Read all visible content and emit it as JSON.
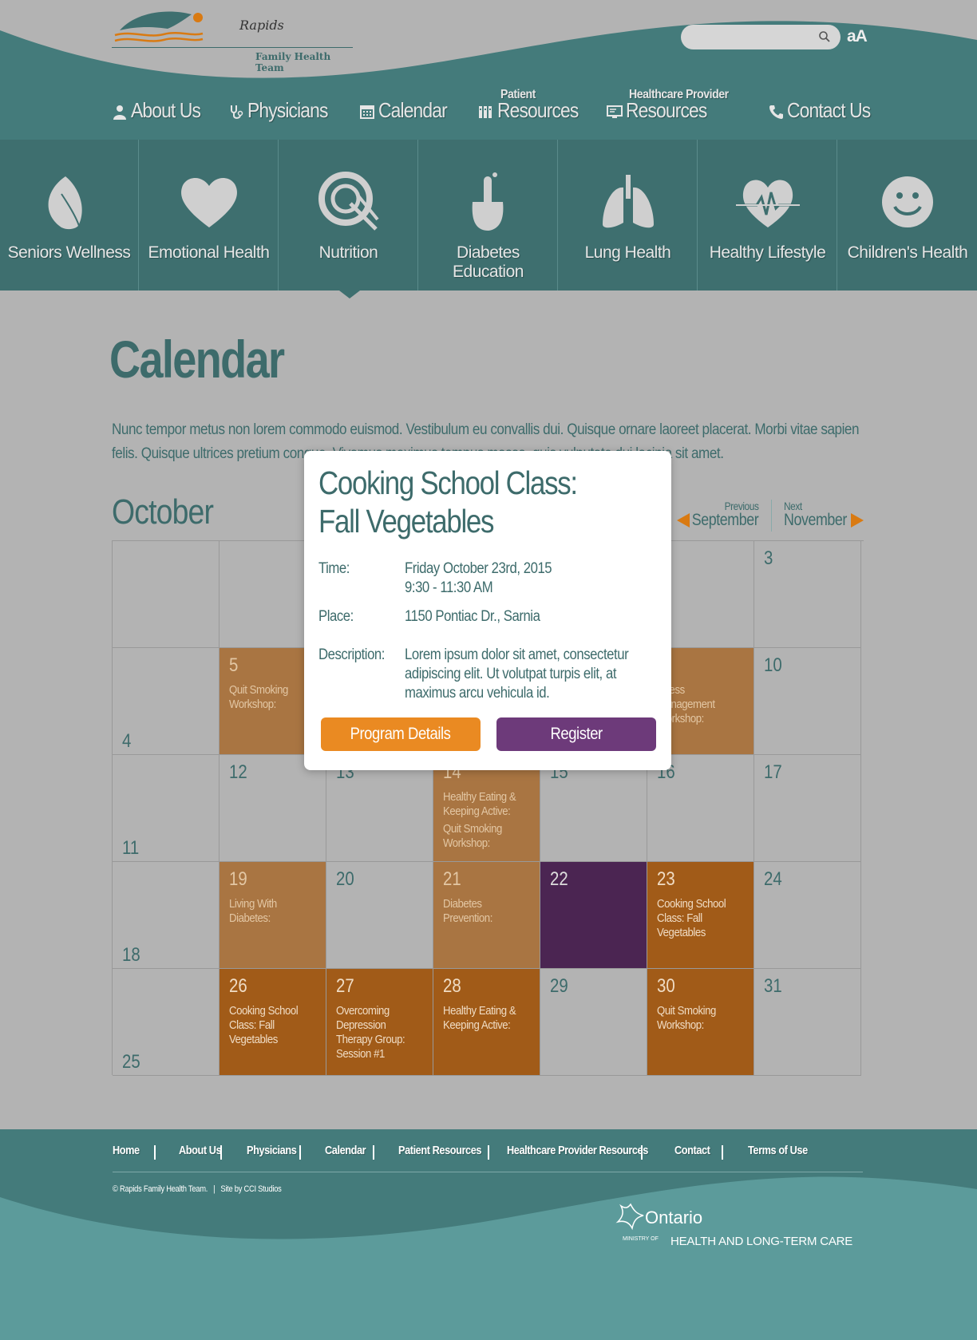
{
  "brand": {
    "name_top": "Rapids",
    "name_bottom": "Family Health Team"
  },
  "header": {
    "search_placeholder": "",
    "text_size_label": "aA"
  },
  "nav": [
    {
      "label": "About Us",
      "sup": "",
      "icon": "person-icon"
    },
    {
      "label": "Physicians",
      "sup": "",
      "icon": "stethoscope-icon"
    },
    {
      "label": "Calendar",
      "sup": "",
      "icon": "calendar-icon"
    },
    {
      "label": "Resources",
      "sup": "Patient",
      "icon": "books-icon"
    },
    {
      "label": "Resources",
      "sup": "Healthcare Provider",
      "icon": "monitor-icon"
    },
    {
      "label": "Contact Us",
      "sup": "",
      "icon": "phone-icon"
    }
  ],
  "categories": [
    {
      "label": "Seniors Wellness",
      "icon": "leaf-icon"
    },
    {
      "label": "Emotional Health",
      "icon": "heart-icon"
    },
    {
      "label": "Nutrition",
      "icon": "plate-fork-knife-icon",
      "active": true
    },
    {
      "label": "Diabetes Education",
      "icon": "finger-prick-icon"
    },
    {
      "label": "Lung Health",
      "icon": "lungs-icon"
    },
    {
      "label": "Healthy Lifestyle",
      "icon": "heartbeat-icon"
    },
    {
      "label": "Children's Health",
      "icon": "smiley-icon"
    }
  ],
  "page": {
    "title": "Calendar",
    "intro": "Nunc tempor metus non lorem commodo euismod. Vestibulum eu convallis dui. Quisque ornare laoreet placerat. Morbi vitae sapien felis. Quisque ultrices pretium congue. Vivamus maximus tempus massa, quis vulputate dui lacinia sit amet."
  },
  "calendar": {
    "month": "October",
    "prev_small": "Previous",
    "prev_big": "September",
    "next_small": "Next",
    "next_big": "November",
    "days": [
      {
        "num": "",
        "style": "",
        "events": []
      },
      {
        "num": "",
        "style": "",
        "events": []
      },
      {
        "num": "",
        "style": "",
        "events": []
      },
      {
        "num": "",
        "style": "",
        "events": []
      },
      {
        "num": "",
        "style": "",
        "events": []
      },
      {
        "num": "",
        "style": "",
        "events": []
      },
      {
        "num": "3",
        "style": "",
        "events": []
      },
      {
        "num": "4",
        "style": "",
        "events": [],
        "bottom": true
      },
      {
        "num": "5",
        "style": "light",
        "events": [
          "Quit Smoking Workshop:"
        ]
      },
      {
        "num": "",
        "style": "",
        "events": []
      },
      {
        "num": "",
        "style": "",
        "events": []
      },
      {
        "num": "",
        "style": "",
        "events": []
      },
      {
        "num": "",
        "style": "light",
        "events": [
          "Stress Management Workshop:"
        ]
      },
      {
        "num": "10",
        "style": "",
        "events": []
      },
      {
        "num": "11",
        "style": "",
        "events": [],
        "bottom": true
      },
      {
        "num": "12",
        "style": "",
        "events": []
      },
      {
        "num": "13",
        "style": "",
        "events": []
      },
      {
        "num": "14",
        "style": "light",
        "events": [
          "Healthy Eating & Keeping Active:",
          "Quit Smoking Workshop:"
        ]
      },
      {
        "num": "15",
        "style": "",
        "events": []
      },
      {
        "num": "16",
        "style": "",
        "events": []
      },
      {
        "num": "17",
        "style": "",
        "events": []
      },
      {
        "num": "18",
        "style": "",
        "events": [],
        "bottom": true
      },
      {
        "num": "19",
        "style": "light",
        "events": [
          "Living With Diabetes:"
        ]
      },
      {
        "num": "20",
        "style": "",
        "events": []
      },
      {
        "num": "21",
        "style": "light",
        "events": [
          "Diabetes Prevention:"
        ]
      },
      {
        "num": "22",
        "style": "purple",
        "events": []
      },
      {
        "num": "23",
        "style": "dark",
        "events": [
          "Cooking School Class: Fall Vegetables"
        ]
      },
      {
        "num": "24",
        "style": "",
        "events": []
      },
      {
        "num": "25",
        "style": "",
        "events": [],
        "bottom": true
      },
      {
        "num": "26",
        "style": "dark",
        "events": [
          "Cooking School Class: Fall Vegetables"
        ]
      },
      {
        "num": "27",
        "style": "dark",
        "events": [
          "Overcoming Depression Therapy Group: Session #1"
        ]
      },
      {
        "num": "28",
        "style": "dark",
        "events": [
          "Healthy Eating & Keeping Active:"
        ]
      },
      {
        "num": "29",
        "style": "",
        "events": []
      },
      {
        "num": "30",
        "style": "dark",
        "events": [
          "Quit Smoking Workshop:"
        ]
      },
      {
        "num": "31",
        "style": "",
        "events": []
      }
    ]
  },
  "modal": {
    "title_line1": "Cooking School Class:",
    "title_line2": "Fall Vegetables",
    "time_label": "Time:",
    "time_line1": "Friday October 23rd, 2015",
    "time_line2": "9:30 - 11:30 AM",
    "place_label": "Place:",
    "place_value": "1150 Pontiac Dr., Sarnia",
    "desc_label": "Description:",
    "desc_line1": "Lorem ipsum dolor sit amet, consectetur",
    "desc_line2": "adipiscing elit. Ut volutpat turpis elit, at",
    "desc_line3": "maximus arcu vehicula id.",
    "details_button": "Program Details",
    "register_button": "Register"
  },
  "footer": {
    "links": [
      "Home",
      "About Us",
      "Physicians",
      "Calendar",
      "Patient Resources",
      "Healthcare Provider Resources",
      "Contact",
      "Terms of Use"
    ],
    "copyright": "© Rapids Family Health Team.",
    "site_by": "Site by CCI Studios",
    "ontario_name": "Ontario",
    "ministry_of": "MINISTRY OF",
    "ministry_dept": "HEALTH AND LONG-TERM CARE"
  },
  "colors": {
    "teal_dark": "#3e6f6f",
    "orange_accent": "#ea8a22",
    "purple_accent": "#6d3a7a"
  }
}
